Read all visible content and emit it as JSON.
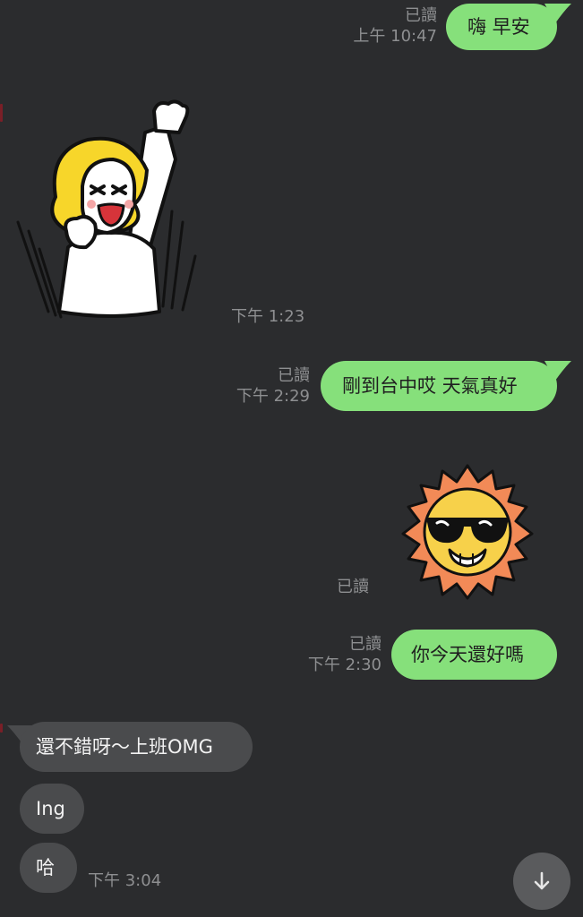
{
  "theme": {
    "background": "#2b2c2e",
    "outgoing_bubble": "#86e07b",
    "incoming_bubble": "#4a4b4d",
    "meta_text": "#8e8f91"
  },
  "messages": [
    {
      "direction": "out",
      "type": "text",
      "text": "嗨 早安",
      "read": "已讀",
      "time": "上午 10:47"
    },
    {
      "direction": "in",
      "type": "sticker",
      "sticker": "cheering-blonde-character-sticker",
      "time": "下午 1:23"
    },
    {
      "direction": "out",
      "type": "text",
      "text": "剛到台中哎 天氣真好",
      "read": "已讀",
      "time": "下午 2:29"
    },
    {
      "direction": "out",
      "type": "sticker",
      "sticker": "cool-sun-sunglasses-sticker",
      "read": "已讀"
    },
    {
      "direction": "out",
      "type": "text",
      "text": "你今天還好嗎",
      "read": "已讀",
      "time": "下午 2:30"
    },
    {
      "direction": "in",
      "type": "text",
      "text": "還不錯呀～上班OMG"
    },
    {
      "direction": "in",
      "type": "text",
      "text": "Ing"
    },
    {
      "direction": "in",
      "type": "text",
      "text": "哈",
      "time": "下午 3:04"
    }
  ],
  "scroll_button": {
    "icon": "arrow-down-icon"
  }
}
